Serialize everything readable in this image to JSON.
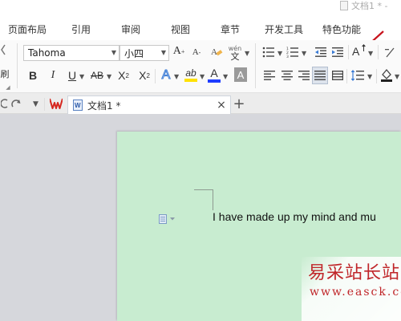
{
  "window": {
    "doc_title": "文档1 * -"
  },
  "menu": {
    "items": [
      "页面布局",
      "引用",
      "审阅",
      "视图",
      "章节",
      "开发工具",
      "特色功能"
    ]
  },
  "ribbon": {
    "font_name": "Tahoma",
    "font_size": "小四",
    "grow_font": "A",
    "shrink_font": "A",
    "phonetic_top": "wén",
    "phonetic_bottom": "文",
    "bold": "B",
    "italic": "I",
    "underline": "U",
    "strikethrough": "AB",
    "superscript": "X",
    "superscript_mark": "2",
    "subscript": "X",
    "subscript_mark": "2",
    "text_effect": "A",
    "highlight": "ab",
    "font_color": "A",
    "char_shading": "A",
    "clip_left_top": "",
    "clip_left_bottom": "刷",
    "colors": {
      "highlight_yellow": "#ffe100",
      "font_color_blue": "#1f3cff",
      "char_shading_gray": "#9a9a9a",
      "text_effect_blue": "#3a7bd5"
    }
  },
  "tabs": {
    "doc_tab_label": "文档1 *",
    "close": "×",
    "add": "+"
  },
  "document": {
    "body_text": "I have made up my mind and mu",
    "page_color": "#c8ecd0"
  },
  "watermark": {
    "cn": "易采站长站",
    "url": "www.easck.com"
  },
  "annotation": {
    "arrow_color": "#c8141e"
  }
}
